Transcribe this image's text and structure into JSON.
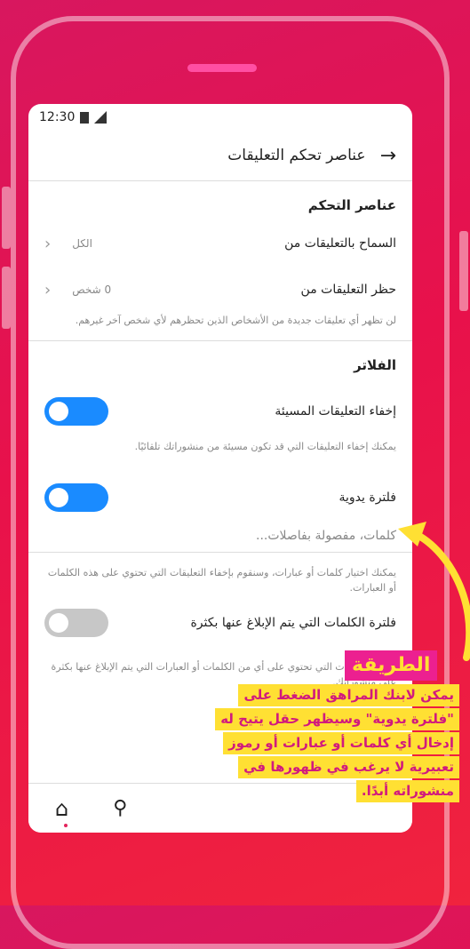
{
  "statusbar": {
    "time": "12:30"
  },
  "header": {
    "title": "عناصر تحكم التعليقات",
    "back_icon": "arrow-right-icon"
  },
  "controls": {
    "section_title": "عناصر التحكم",
    "allow_from": {
      "label": "السماح بالتعليقات من",
      "value": "الكل"
    },
    "block_from": {
      "label": "حظر التعليقات من",
      "value": "0 شخص"
    },
    "block_note": "لن تظهر أي تعليقات جديدة من الأشخاص الذين تحظرهم لأي شخص آخر غيرهم."
  },
  "filters": {
    "section_title": "الفلاتر",
    "hide_offensive": {
      "label": "إخفاء التعليقات المسيئة",
      "note": "يمكنك إخفاء التعليقات التي قد تكون مسيئة من منشوراتك تلقائيًا.",
      "enabled": true
    },
    "manual_filter": {
      "label": "فلترة يدوية",
      "placeholder": "كلمات، مفصولة بفاصلات...",
      "enabled": true
    },
    "manual_note": "يمكنك اختيار كلمات أو عبارات، وسنقوم بإخفاء التعليقات التي تحتوي على هذه الكلمات أو العبارات.",
    "most_reported": {
      "label": "فلترة الكلمات التي يتم الإبلاغ عنها بكثرة",
      "note": "إخفاء التعليقات التي تحتوي على أي من الكلمات أو العبارات التي يتم الإبلاغ عنها بكثرة على منشوراتك.",
      "enabled": false
    }
  },
  "bottom_nav": {
    "items": [
      "home-icon",
      "search-icon"
    ]
  },
  "callout": {
    "title": "الطريقة",
    "lines": [
      "يمكن لابنك المراهق الضغط على",
      "\"فلترة يدوية\" وسيظهر حقل يتيح له",
      "إدخال أي كلمات أو عبارات أو رموز",
      "تعبيرية لا يرغب في ظهورها في",
      "منشوراته أبدًا."
    ]
  },
  "colors": {
    "background": "#e8114b",
    "accent": "#1a8bff",
    "highlight": "#ffe033",
    "callout_text": "#d11a7e"
  }
}
